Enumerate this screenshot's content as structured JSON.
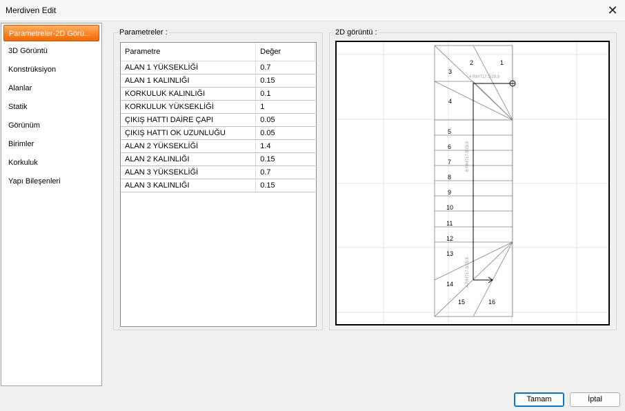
{
  "window": {
    "title": "Merdiven Edit"
  },
  "sidebar": {
    "items": [
      {
        "label": "Parametreler-2D Görü..."
      },
      {
        "label": "3D Görüntü"
      },
      {
        "label": "Konstrüksiyon"
      },
      {
        "label": "Alanlar"
      },
      {
        "label": "Statik"
      },
      {
        "label": "Görünüm"
      },
      {
        "label": "Birimler"
      },
      {
        "label": "Korkuluk"
      },
      {
        "label": "Yapı Bileşenleri"
      }
    ]
  },
  "params": {
    "group_label": "Parametreler :",
    "col_param": "Parametre",
    "col_value": "Değer",
    "rows": [
      {
        "name": "ALAN 1 YÜKSEKLİĞİ",
        "value": "0.7"
      },
      {
        "name": "ALAN 1 KALINLIĞI",
        "value": "0.15"
      },
      {
        "name": "KORKULUK KALINLIĞI",
        "value": "0.1"
      },
      {
        "name": "KORKULUK YÜKSEKLİĞİ",
        "value": "1"
      },
      {
        "name": "ÇIKIŞ HATTI DAİRE ÇAPI",
        "value": "0.05"
      },
      {
        "name": "ÇIKIŞ HATTI OK UZUNLUĞU",
        "value": "0.05"
      },
      {
        "name": "ALAN 2 YÜKSEKLİĞİ",
        "value": "1.4"
      },
      {
        "name": "ALAN 2 KALINLIĞI",
        "value": "0.15"
      },
      {
        "name": "ALAN 3 YÜKSEKLİĞİ",
        "value": "0.7"
      },
      {
        "name": "ALAN 3 KALINLIĞI",
        "value": "0.15"
      }
    ]
  },
  "preview": {
    "group_label": "2D görüntü :",
    "step_numbers": [
      "1",
      "2",
      "3",
      "4",
      "5",
      "6",
      "7",
      "8",
      "9",
      "10",
      "11",
      "12",
      "13",
      "14",
      "15",
      "16"
    ],
    "annotations": [
      "4 RIHT17.5/29.9",
      "8 RIHT17.5/29.9",
      "4 RIHT17.5/29.8"
    ]
  },
  "buttons": {
    "ok": "Tamam",
    "cancel": "İptal"
  },
  "icons": {
    "close": "close-icon"
  }
}
